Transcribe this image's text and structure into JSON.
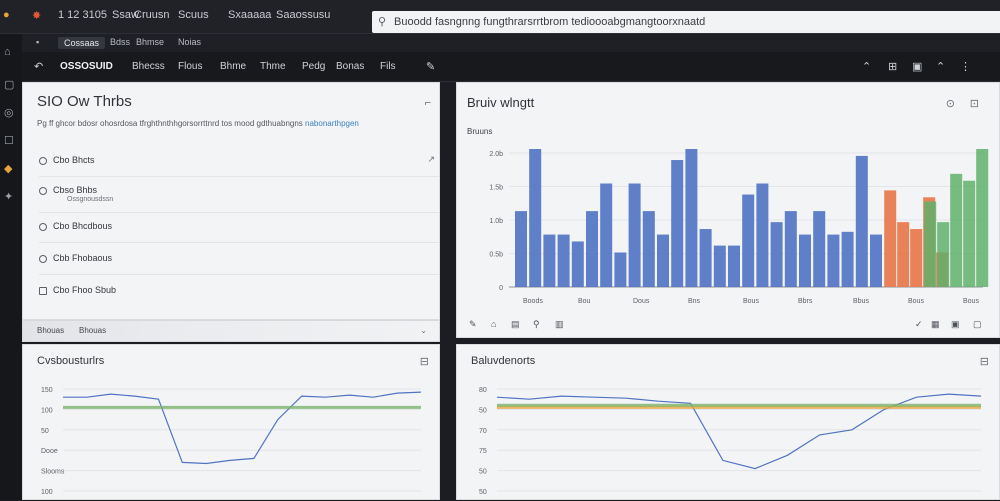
{
  "browser": {
    "tabs": [
      "1 12 3105",
      "Ssaw",
      "Cruusn",
      "Scuus",
      "Saaossusu",
      "Sxaaaaa"
    ],
    "address": "Buoodd fasngnng fungthrarsrrtbrom tedioooabgmangtoorxnaatd",
    "subnav": [
      "Cossaas",
      "Bdss",
      "Bhmse",
      "Noias"
    ]
  },
  "appbar": {
    "brand": "OSSOSUID",
    "items": [
      "Bhecss",
      "Flous",
      "Bhme",
      "Thme",
      "Pedg",
      "Bonas",
      "Fils"
    ]
  },
  "checklist": {
    "title": "SIO Ow Thrbs",
    "description": "Pg ff ghcor bdosr ohosrdosa tfrghthnthhgorsorrttnrd tos mood gdthuabngns",
    "description_link": "nabonarthpgen",
    "items": [
      {
        "label": "Cbo Bhcts",
        "sub": ""
      },
      {
        "label": "Cbso Bhbs",
        "sub": "Ossgnousdssn"
      },
      {
        "label": "Cbo Bhcdbous",
        "sub": ""
      },
      {
        "label": "Cbb Fhobaous",
        "sub": ""
      },
      {
        "label": "Cbo Fhoo Sbub",
        "sub": ""
      }
    ],
    "footer_left": "Bhouas",
    "footer_right": "Bhouas"
  },
  "bar_panel": {
    "title": "Bruiv wlngtt",
    "subtitle": "Bruuns",
    "icons": [
      "refresh-icon",
      "expand-icon"
    ]
  },
  "line_left": {
    "title": "Cvsbousturlrs"
  },
  "line_right": {
    "title": "Baluvdenorts"
  },
  "chart_data": [
    {
      "type": "bar",
      "title": "Bruiv wlngtt",
      "yticks": [
        "2.0b",
        "1.5b",
        "1.0b",
        "0.5b",
        "0"
      ],
      "xticks": [
        "Boods",
        "Bou",
        "Dous",
        "Bns",
        "Bous",
        "Bbrs",
        "Bbus",
        "Bous",
        "Bous"
      ],
      "series": [
        {
          "color": "#4f73c3",
          "values": [
            0.55,
            1.0,
            0.38,
            0.38,
            0.33,
            0.55,
            0.75,
            0.25,
            0.75,
            0.55,
            0.38,
            0.92,
            1.0,
            0.42,
            0.3,
            0.3,
            0.67,
            0.75,
            0.47,
            0.55,
            0.38,
            0.55,
            0.38,
            0.4,
            0.95,
            0.38
          ]
        },
        {
          "color": "#e8774a",
          "values": [
            0.7,
            0.47,
            0.42,
            0.65,
            0.25
          ]
        },
        {
          "color": "#5fb06a",
          "values": [
            0.62,
            0.47,
            0.82,
            0.77,
            1.0
          ]
        }
      ]
    },
    {
      "type": "line",
      "title": "Cvsbousturlrs",
      "yticks": [
        "150",
        "100",
        "50",
        "Dooe",
        "Slooms",
        "100"
      ],
      "series": [
        {
          "color": "#4f73c3",
          "values": [
            0.92,
            0.92,
            0.95,
            0.93,
            0.9,
            0.28,
            0.27,
            0.3,
            0.32,
            0.7,
            0.93,
            0.92,
            0.94,
            0.92,
            0.96,
            0.97
          ]
        },
        {
          "color": "#7ab36a",
          "values": [
            0.82,
            0.82,
            0.82,
            0.82,
            0.82,
            0.82,
            0.82,
            0.82,
            0.82,
            0.82
          ]
        }
      ]
    },
    {
      "type": "line",
      "title": "Baluvdenorts",
      "yticks": [
        "80",
        "50",
        "70",
        "75",
        "50",
        "50"
      ],
      "series": [
        {
          "color": "#4f73c3",
          "values": [
            0.92,
            0.9,
            0.93,
            0.92,
            0.91,
            0.88,
            0.86,
            0.3,
            0.22,
            0.35,
            0.55,
            0.6,
            0.8,
            0.92,
            0.95,
            0.93
          ]
        },
        {
          "color": "#e7a63b",
          "values": [
            0.82,
            0.82,
            0.82,
            0.82,
            0.82,
            0.82,
            0.82,
            0.82
          ]
        },
        {
          "color": "#7ab36a",
          "values": [
            0.84,
            0.84,
            0.84,
            0.84,
            0.84,
            0.84,
            0.84,
            0.84
          ]
        }
      ]
    }
  ]
}
